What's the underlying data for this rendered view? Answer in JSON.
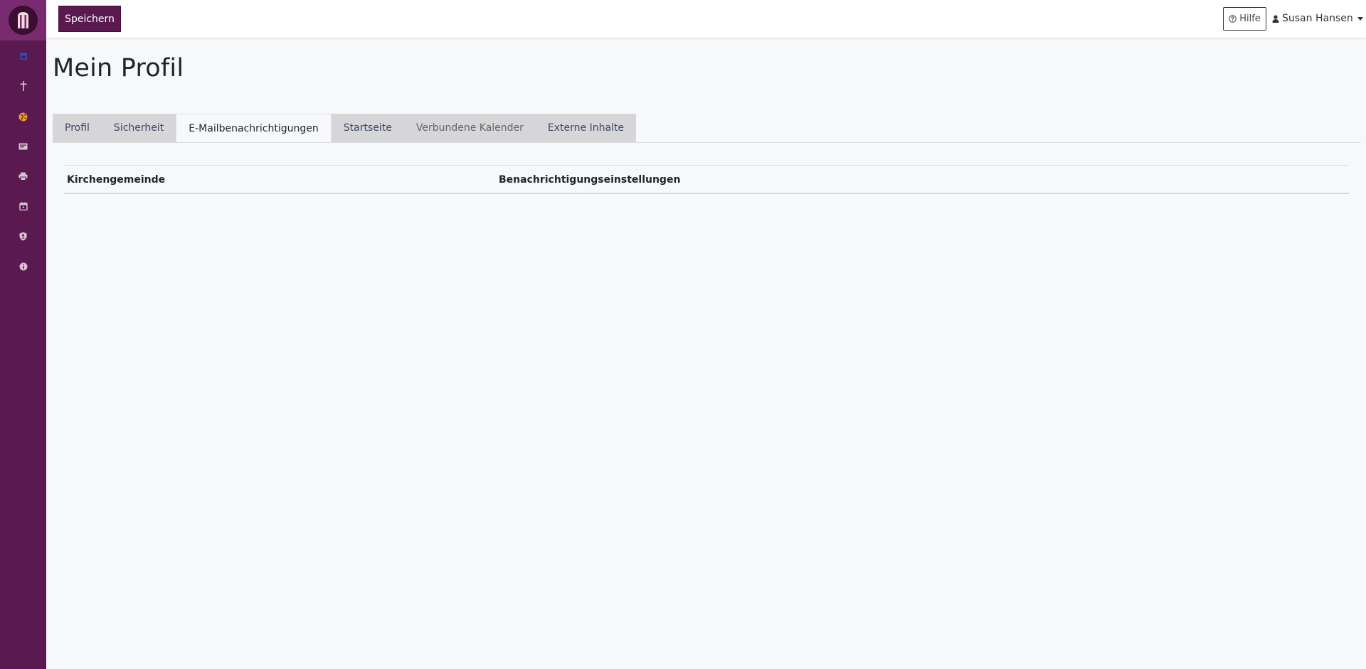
{
  "toolbar": {
    "save_label": "Speichern"
  },
  "header": {
    "help_label": "Hilfe",
    "user_name": "Susan Hansen"
  },
  "page": {
    "title": "Mein Profil"
  },
  "tabs": [
    {
      "label": "Profil",
      "state": "link"
    },
    {
      "label": "Sicherheit",
      "state": "link"
    },
    {
      "label": "E-Mailbenachrichtigungen",
      "state": "active"
    },
    {
      "label": "Startseite",
      "state": "link"
    },
    {
      "label": "Verbundene Kalender",
      "state": "muted"
    },
    {
      "label": "Externe Inhalte",
      "state": "link"
    }
  ],
  "table": {
    "columns": [
      "Kirchengemeinde",
      "Benachrichtigungseinstellungen"
    ],
    "rows": []
  },
  "sidebar": {
    "icons": [
      "calendar-icon",
      "cross-icon",
      "globe-icon",
      "card-icon",
      "printer-icon",
      "calendar-day-icon",
      "user-shield-icon",
      "info-icon"
    ]
  },
  "colors": {
    "brand": "#5a1a50",
    "brand_light": "#7a2a6e",
    "tab_inactive": "#d6d6d9",
    "link": "#3b4a6b",
    "globe_accent": "#f0a020",
    "calendar_accent": "#3a4cc0"
  }
}
